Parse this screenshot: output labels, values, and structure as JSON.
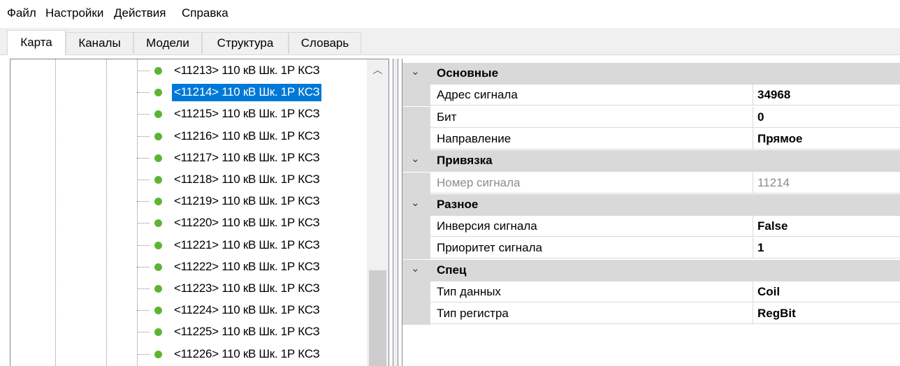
{
  "menu": [
    "Файл",
    "Настройки",
    "Действия",
    "Справка"
  ],
  "tabs": [
    {
      "label": "Карта",
      "active": true
    },
    {
      "label": "Каналы",
      "active": false
    },
    {
      "label": "Модели",
      "active": false
    },
    {
      "label": "Структура",
      "active": false
    },
    {
      "label": "Словарь",
      "active": false
    }
  ],
  "tree": {
    "items": [
      "<11213> 110 кВ Шк. 1Р КСЗ",
      "<11214> 110 кВ Шк. 1Р КСЗ",
      "<11215> 110 кВ Шк. 1Р КСЗ",
      "<11216> 110 кВ Шк. 1Р КСЗ",
      "<11217> 110 кВ Шк. 1Р КСЗ",
      "<11218> 110 кВ Шк. 1Р КСЗ",
      "<11219> 110 кВ Шк. 1Р КСЗ",
      "<11220> 110 кВ Шк. 1Р КСЗ",
      "<11221> 110 кВ Шк. 1Р КСЗ",
      "<11222> 110 кВ Шк. 1Р КСЗ",
      "<11223> 110 кВ Шк. 1Р КСЗ",
      "<11224> 110 кВ Шк. 1Р КСЗ",
      "<11225> 110 кВ Шк. 1Р КСЗ",
      "<11226> 110 кВ Шк. 1Р КСЗ"
    ],
    "selected_index": 1,
    "status_color": "#5cb531",
    "selection_color": "#0078d7",
    "scroll_up_icon": "chevron-up-icon"
  },
  "properties": {
    "chevron_icon": "chevron-down-icon",
    "categories": [
      {
        "name": "Основные",
        "items": [
          {
            "name": "Адрес сигнала",
            "value": "34968",
            "readonly": false
          },
          {
            "name": "Бит",
            "value": "0",
            "readonly": false
          },
          {
            "name": "Направление",
            "value": "Прямое",
            "readonly": false
          }
        ]
      },
      {
        "name": "Привязка",
        "items": [
          {
            "name": "Номер сигнала",
            "value": "11214",
            "readonly": true
          }
        ]
      },
      {
        "name": "Разное",
        "items": [
          {
            "name": "Инверсия сигнала",
            "value": "False",
            "readonly": false
          },
          {
            "name": "Приоритет сигнала",
            "value": "1",
            "readonly": false
          }
        ]
      },
      {
        "name": "Спец",
        "items": [
          {
            "name": "Тип данных",
            "value": "Coil",
            "readonly": false
          },
          {
            "name": "Тип регистра",
            "value": "RegBit",
            "readonly": false
          }
        ]
      }
    ]
  }
}
